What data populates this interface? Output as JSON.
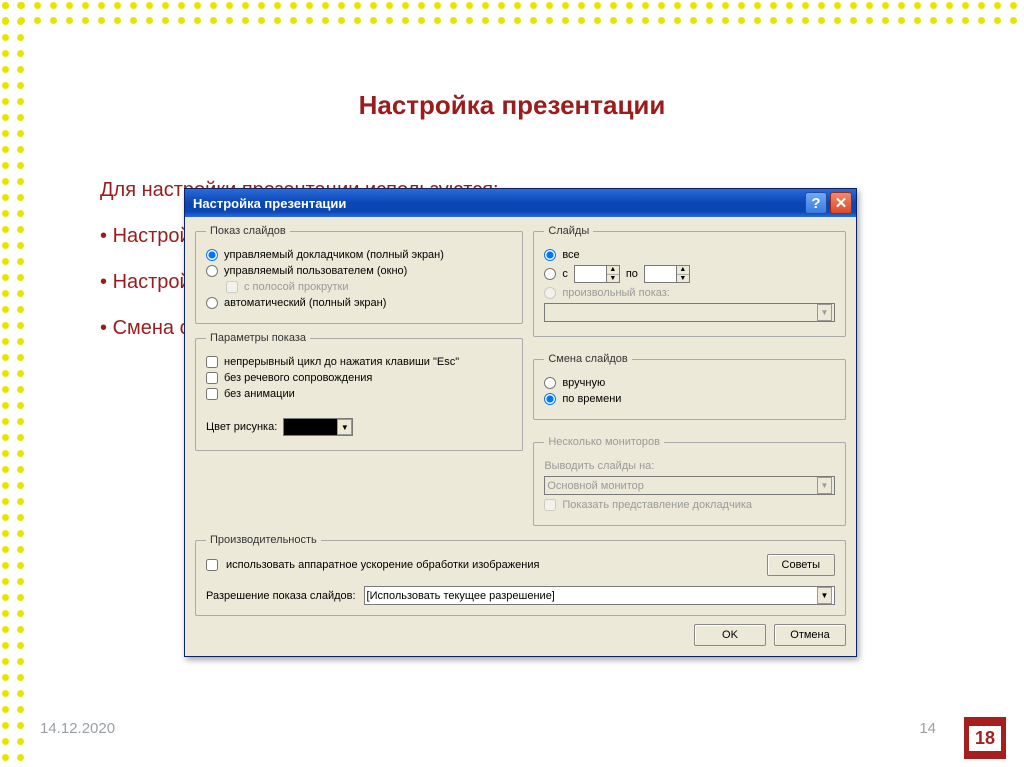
{
  "slide": {
    "title": "Настройка презентации",
    "intro": "Для настройки презентации используются:",
    "bullets": [
      "Настройка презентации,",
      "Настройка времени,",
      "Смена слайдов"
    ]
  },
  "footer": {
    "date": "14.12.2020",
    "page": "14",
    "corner": "18"
  },
  "dialog": {
    "title": "Настройка презентации",
    "groups": {
      "show": {
        "legend": "Показ слайдов",
        "opt1": "управляемый докладчиком (полный экран)",
        "opt2": "управляемый пользователем (окно)",
        "opt2a": "с полосой прокрутки",
        "opt3": "автоматический (полный экран)"
      },
      "params": {
        "legend": "Параметры показа",
        "chk1": "непрерывный цикл до нажатия клавиши \"Esc\"",
        "chk2": "без речевого сопровождения",
        "chk3": "без анимации",
        "colorLabel": "Цвет рисунка:"
      },
      "slides": {
        "legend": "Слайды",
        "all": "все",
        "from": "с",
        "to": "по",
        "custom": "произвольный показ:"
      },
      "advance": {
        "legend": "Смена слайдов",
        "opt1": "вручную",
        "opt2": "по времени"
      },
      "monitors": {
        "legend": "Несколько мониторов",
        "label": "Выводить слайды на:",
        "value": "Основной монитор",
        "chk": "Показать представление докладчика"
      },
      "perf": {
        "legend": "Производительность",
        "chk": "использовать аппаратное ускорение обработки изображения",
        "tips": "Советы",
        "resLabel": "Разрешение показа слайдов:",
        "resValue": "[Использовать текущее разрешение]"
      }
    },
    "buttons": {
      "ok": "OK",
      "cancel": "Отмена"
    }
  }
}
